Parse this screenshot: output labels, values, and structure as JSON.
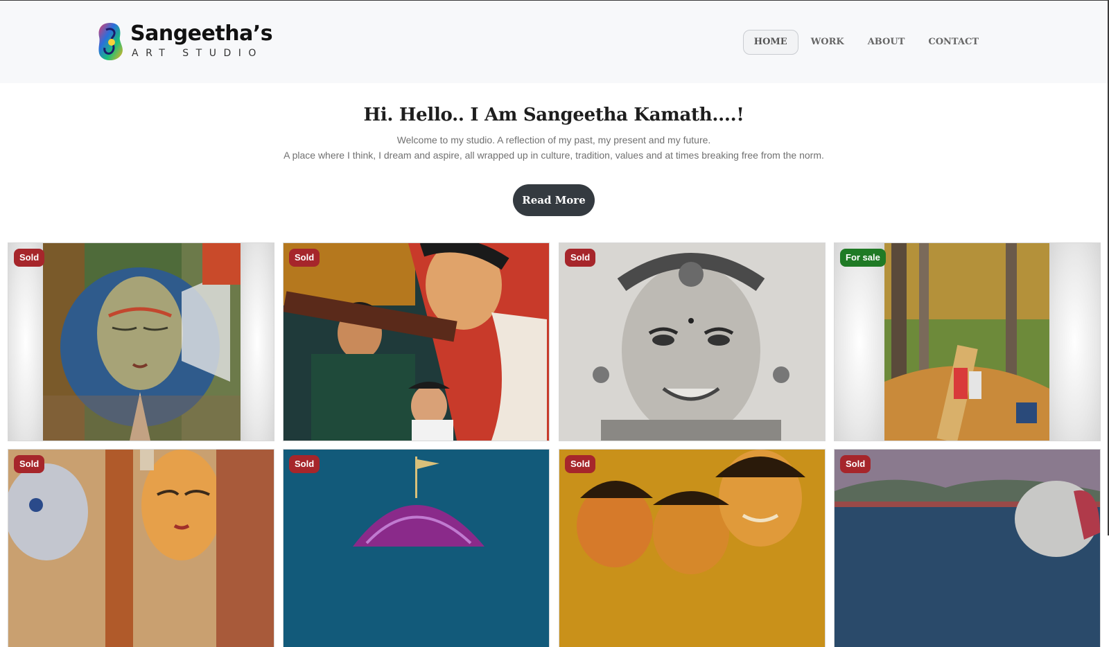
{
  "brand": {
    "name": "Sangeetha’s",
    "sub": "ART STUDIO"
  },
  "nav": [
    {
      "label": "HOME",
      "active": true
    },
    {
      "label": "WORK"
    },
    {
      "label": "ABOUT"
    },
    {
      "label": "CONTACT"
    }
  ],
  "intro": {
    "title": "Hi. Hello.. I Am Sangeetha Kamath....!",
    "line1": "Welcome to my studio. A reflection of my past, my present and my future.",
    "line2": "A place where I think, I dream and aspire, all wrapped up in culture, tradition, values and at times breaking free from the norm.",
    "read_more": "Read More"
  },
  "gallery": [
    {
      "status": "Sold",
      "theme": "buddha-face"
    },
    {
      "status": "Sold",
      "theme": "veena-mother-children"
    },
    {
      "status": "Sold",
      "theme": "pencil-girl-portrait"
    },
    {
      "status": "For sale",
      "theme": "forest-children"
    },
    {
      "status": "Sold",
      "theme": "faces-elephant"
    },
    {
      "status": "Sold",
      "theme": "purple-dome"
    },
    {
      "status": "Sold",
      "theme": "smiling-children"
    },
    {
      "status": "Sold",
      "theme": "lake-elephant"
    }
  ],
  "colors": {
    "sold_badge": "#a6262b",
    "for_sale_badge": "#1f7a25",
    "button": "#343a40",
    "header_bg": "#f7f8fa"
  }
}
